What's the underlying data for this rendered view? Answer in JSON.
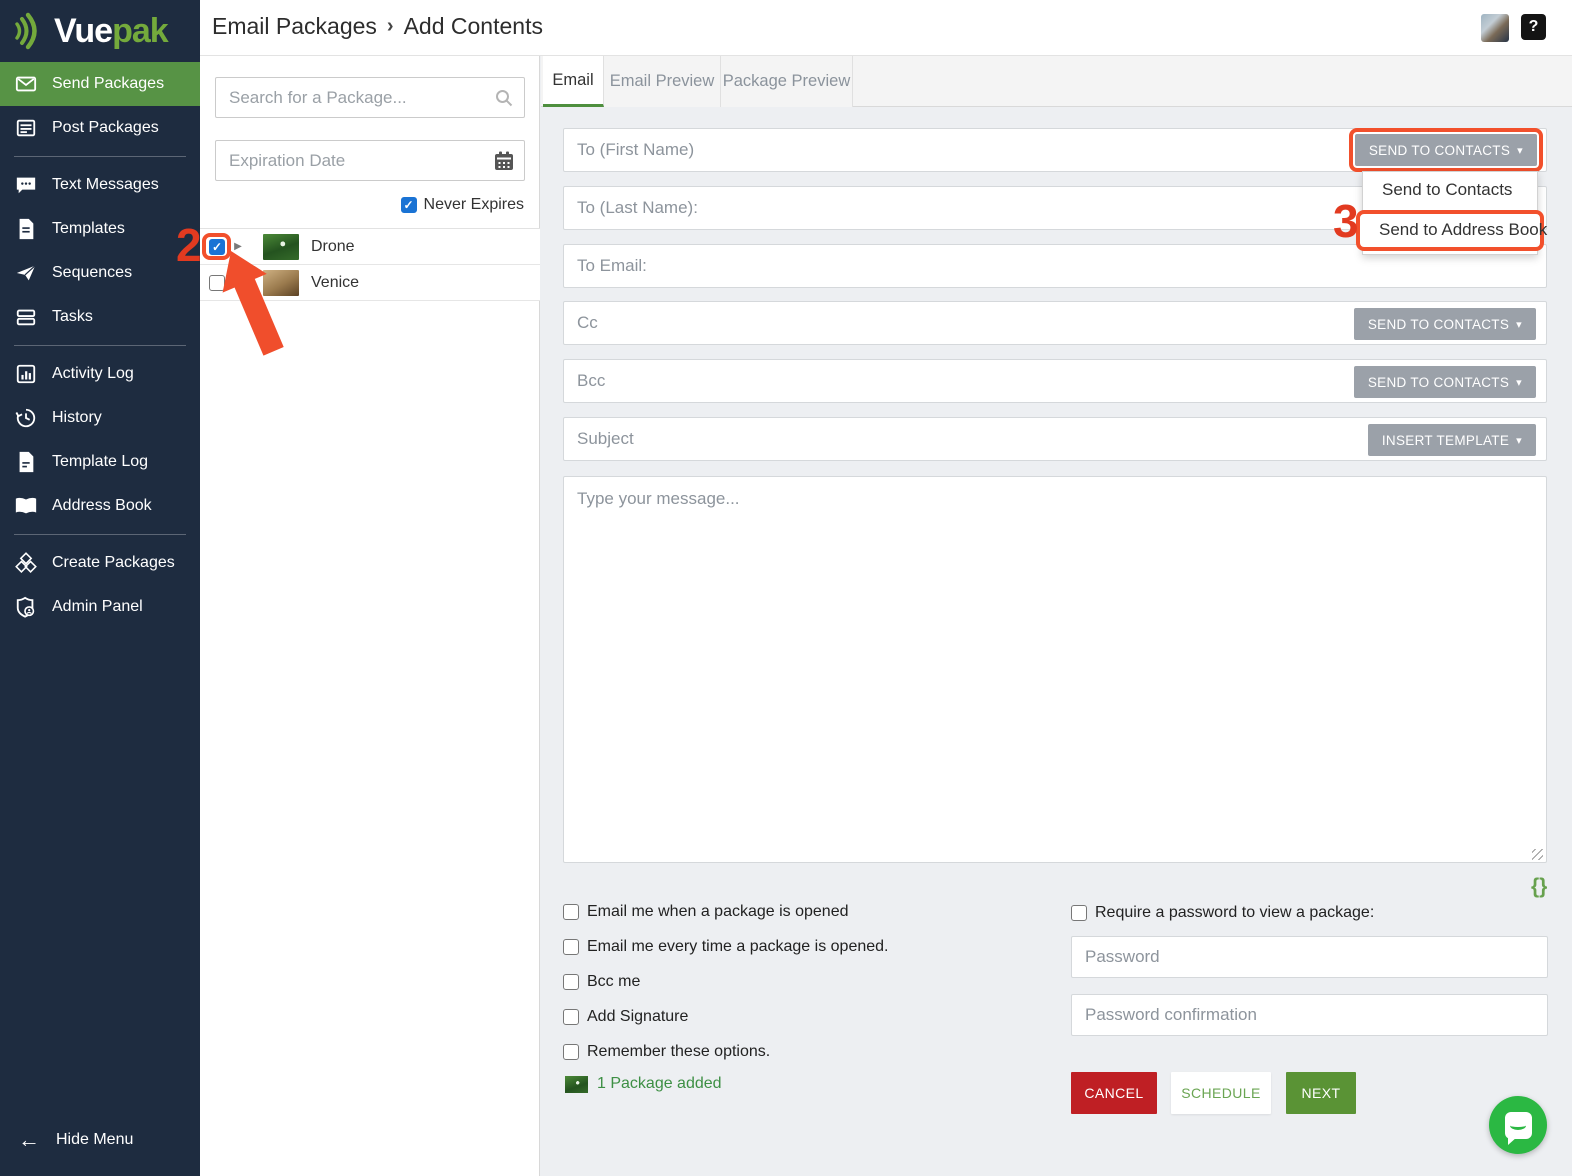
{
  "colors": {
    "sidebar_navy": "#1e2c40",
    "accent_green": "#579345",
    "logo_green": "#74aa3c",
    "annotation_orange": "#f2502c",
    "step_number_red": "#e23a20",
    "checkbox_blue": "#1a73d4",
    "cancel_red": "#bf1f24",
    "next_green": "#5a9335",
    "chat_green": "#2bb843",
    "gray_button": "#9ba1a9"
  },
  "brand": {
    "logo_primary": "Vue",
    "logo_secondary": "pak"
  },
  "sidebar": {
    "items": [
      {
        "label": "Send Packages",
        "icon": "envelope-icon",
        "active": true
      },
      {
        "label": "Post Packages",
        "icon": "post-icon",
        "active": false
      },
      {
        "label": "Text Messages",
        "icon": "chat-bubble-icon",
        "active": false
      },
      {
        "label": "Templates",
        "icon": "template-file-icon",
        "active": false
      },
      {
        "label": "Sequences",
        "icon": "paper-plane-icon",
        "active": false
      },
      {
        "label": "Tasks",
        "icon": "tasks-icon",
        "active": false
      },
      {
        "label": "Activity Log",
        "icon": "bar-chart-icon",
        "active": false
      },
      {
        "label": "History",
        "icon": "history-clock-icon",
        "active": false
      },
      {
        "label": "Template Log",
        "icon": "document-icon",
        "active": false
      },
      {
        "label": "Address Book",
        "icon": "address-book-icon",
        "active": false
      },
      {
        "label": "Create Packages",
        "icon": "cubes-icon",
        "active": false
      },
      {
        "label": "Admin Panel",
        "icon": "admin-shield-icon",
        "active": false
      }
    ],
    "hide_menu_label": "Hide Menu"
  },
  "header": {
    "breadcrumb_root": "Email Packages",
    "breadcrumb_separator": "›",
    "breadcrumb_current": "Add Contents",
    "help_label": "?"
  },
  "packages_panel": {
    "search_placeholder": "Search for a Package...",
    "expiration_placeholder": "Expiration Date",
    "never_expires_label": "Never Expires",
    "never_expires_checked": true,
    "rows": [
      {
        "name": "Drone",
        "checked": true,
        "expandable": true
      },
      {
        "name": "Venice",
        "checked": false,
        "expandable": false
      }
    ]
  },
  "tabs": {
    "email": "Email",
    "email_preview": "Email Preview",
    "package_preview": "Package Preview"
  },
  "form": {
    "to_first_placeholder": "To (First Name)",
    "to_last_placeholder": "To (Last Name):",
    "to_email_placeholder": "To Email:",
    "cc_placeholder": "Cc",
    "bcc_placeholder": "Bcc",
    "subject_placeholder": "Subject",
    "message_placeholder": "Type your message...",
    "send_to_contacts_label": "SEND TO CONTACTS",
    "insert_template_label": "INSERT TEMPLATE",
    "merge_tags_label": "{}"
  },
  "dropdown": {
    "item_contacts": "Send to Contacts",
    "item_address_book": "Send to Address Book"
  },
  "annotations": {
    "step_2": "2",
    "step_3": "3"
  },
  "options": {
    "email_once": "Email me when a package is opened",
    "email_every": "Email me every time a package is opened.",
    "bcc_me": "Bcc me",
    "add_signature": "Add Signature",
    "remember": "Remember these options."
  },
  "password_section": {
    "require_label": "Require a password to view a package:",
    "password_placeholder": "Password",
    "confirm_placeholder": "Password confirmation"
  },
  "actions": {
    "cancel": "CANCEL",
    "schedule": "SCHEDULE",
    "next": "NEXT"
  },
  "status": {
    "package_added": "1 Package added"
  },
  "glyphs": {
    "caret_down": "▾",
    "caret_right": "▶",
    "check": "✓",
    "back_arrow": "←"
  }
}
